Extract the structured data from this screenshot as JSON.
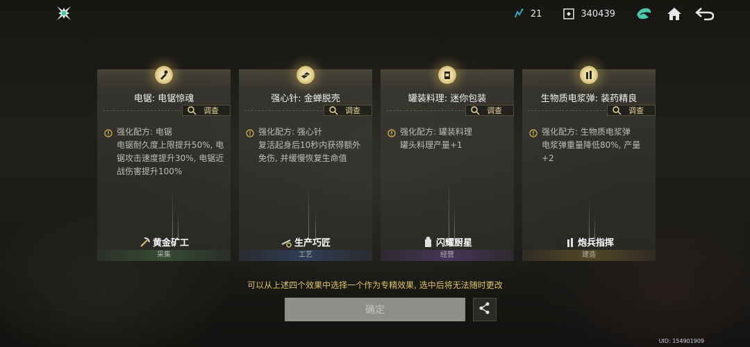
{
  "header": {
    "logo_icon": "shuriken-logo-icon",
    "resource_1": {
      "icon": "energy-icon",
      "value": "21"
    },
    "resource_2": {
      "icon": "currency-icon",
      "value": "340439"
    },
    "buttons": [
      "faction-emblem-icon",
      "home-icon",
      "back-icon"
    ]
  },
  "cards": [
    {
      "badge_icon": "chainsaw-icon",
      "title": "电锯: 电锯惊魂",
      "inspect_label": "调查",
      "recipe_title": "强化配方: 电锯",
      "recipe_body": "电锯耐久度上限提升50%, 电锯攻击速度提升30%, 电锯近战伤害提升100%",
      "role_icon": "pickaxe-icon",
      "role_name": "黄金矿工",
      "category": "采集",
      "category_color": "#3c5a3c"
    },
    {
      "badge_icon": "syringe-icon",
      "title": "强心针: 金蝉脱壳",
      "inspect_label": "调查",
      "recipe_title": "强化配方: 强心针",
      "recipe_body": "复活起身后10秒内获得额外免伤, 并缓慢恢复生命值",
      "role_icon": "wrench-gear-icon",
      "role_name": "生产巧匠",
      "category": "工艺",
      "category_color": "#32466e"
    },
    {
      "badge_icon": "canned-food-icon",
      "title": "罐装料理: 迷你包装",
      "inspect_label": "调查",
      "recipe_title": "强化配方: 罐装料理",
      "recipe_body": "罐头料理产量+1",
      "role_icon": "chef-icon",
      "role_name": "闪耀厨星",
      "category": "经营",
      "category_color": "#503c6e"
    },
    {
      "badge_icon": "shell-icon",
      "title": "生物质电浆弹: 装药精良",
      "inspect_label": "调查",
      "recipe_title": "强化配方: 生物质电浆弹",
      "recipe_body": "电浆弹重量降低80%, 产量+2",
      "role_icon": "artillery-shell-icon",
      "role_name": "炮兵指挥",
      "category": "建造",
      "category_color": "#645528"
    }
  ],
  "notice": "可以从上述四个效果中选择一个作为专精效果, 选中后将无法随时更改",
  "confirm_label": "确定",
  "share_icon": "share-icon",
  "uid": "UID: 154901909"
}
